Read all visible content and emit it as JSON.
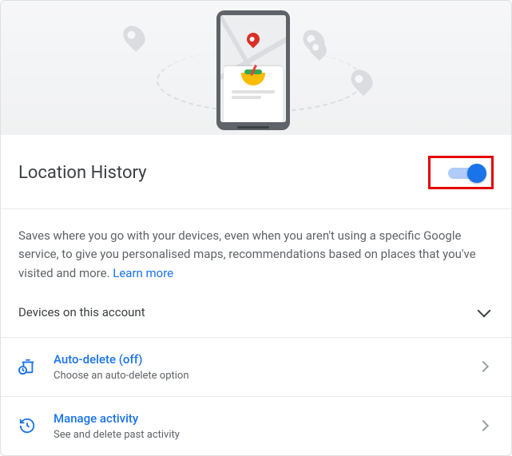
{
  "title": "Location History",
  "toggle_on": true,
  "description": "Saves where you go with your devices, even when you aren't using a specific Google service, to give you personalised maps, recommendations based on places that you've visited and more. ",
  "learn_more": "Learn more",
  "devices_label": "Devices on this account",
  "rows": {
    "auto_delete": {
      "title": "Auto-delete (off)",
      "subtitle": "Choose an auto-delete option"
    },
    "manage": {
      "title": "Manage activity",
      "subtitle": "See and delete past activity"
    }
  }
}
